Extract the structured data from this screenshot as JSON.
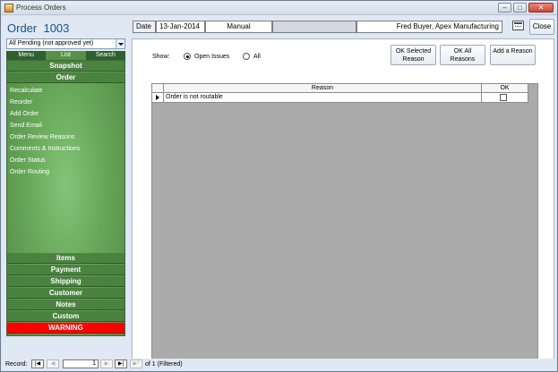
{
  "window": {
    "title": "Process Orders",
    "minimize": "–",
    "maximize": "□",
    "close": "✕"
  },
  "header": {
    "order_label": "Order",
    "order_number": "1003",
    "date_label": "Date",
    "date_value": "13-Jan-2014",
    "entry_type": "Manual",
    "blank_field": "",
    "customer": "Fred Buyer, Apex Manufacturing",
    "close_label": "Close"
  },
  "sidebar": {
    "filter": "All Pending (not approved yet)",
    "tabs": [
      "Menu",
      "List",
      "Search"
    ],
    "sections_top": [
      "Snapshot",
      "Order"
    ],
    "order_items": [
      "Recalculate",
      "Reorder",
      "Add Order",
      "Send Email",
      "Order Review Reasons",
      "Comments & Instructions",
      "Order Status",
      "Order Routing"
    ],
    "sections_bottom": [
      "Items",
      "Payment",
      "Shipping",
      "Customer",
      "Notes",
      "Custom"
    ],
    "warning": "WARNING"
  },
  "content": {
    "show_label": "Show:",
    "radio_open": "Open Issues",
    "radio_all": "All",
    "btn_ok_selected": "OK Selected Reason",
    "btn_ok_all": "OK All Reasons",
    "btn_add": "Add a Reason",
    "grid": {
      "headers": [
        "Reason",
        "OK"
      ],
      "rows": [
        {
          "reason": "Order is not routable",
          "ok": false
        }
      ]
    }
  },
  "record_nav": {
    "label": "Record:",
    "current": "1",
    "of_text": "of 1 (Filtered)"
  },
  "colors": {
    "accent": "#1f4e8a",
    "nav_green": "#4b8240",
    "warning": "#ff0000"
  }
}
